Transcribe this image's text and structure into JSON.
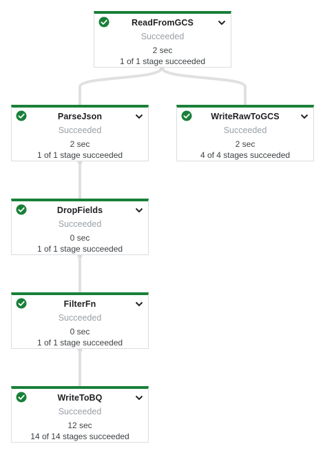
{
  "nodes": [
    {
      "id": "readfromgcs",
      "title": "ReadFromGCS",
      "status": "Succeeded",
      "duration": "2 sec",
      "stages": "1 of 1 stage succeeded"
    },
    {
      "id": "parsejson",
      "title": "ParseJson",
      "status": "Succeeded",
      "duration": "2 sec",
      "stages": "1 of 1 stage succeeded"
    },
    {
      "id": "writerawtogcs",
      "title": "WriteRawToGCS",
      "status": "Succeeded",
      "duration": "2 sec",
      "stages": "4 of 4 stages succeeded"
    },
    {
      "id": "dropfields",
      "title": "DropFields",
      "status": "Succeeded",
      "duration": "0 sec",
      "stages": "1 of 1 stage succeeded"
    },
    {
      "id": "filterfn",
      "title": "FilterFn",
      "status": "Succeeded",
      "duration": "0 sec",
      "stages": "1 of 1 stage succeeded"
    },
    {
      "id": "writetobq",
      "title": "WriteToBQ",
      "status": "Succeeded",
      "duration": "12 sec",
      "stages": "14 of 14 stages succeeded"
    }
  ],
  "icons": {
    "status": "check-circle-icon",
    "expand": "chevron-down-icon"
  },
  "colors": {
    "success": "#188038",
    "edge": "#e0e0e0",
    "border": "#dadce0",
    "muted_text": "#9aa0a6"
  }
}
